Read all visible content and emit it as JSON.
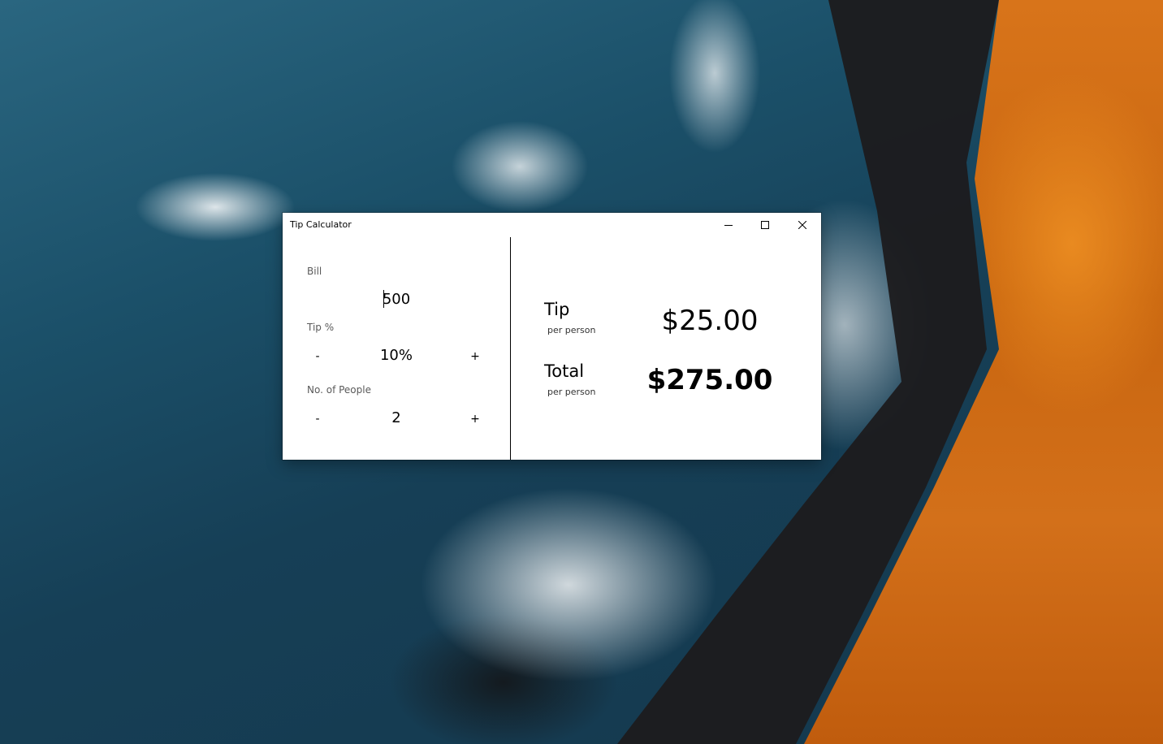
{
  "window": {
    "title": "Tip Calculator"
  },
  "inputs": {
    "bill_label": "Bill",
    "bill_value": "500",
    "tip_label": "Tip %",
    "tip_value": "10%",
    "people_label": "No. of People",
    "people_value": "2",
    "minus_label": "-",
    "plus_label": "+"
  },
  "results": {
    "tip_label": "Tip",
    "tip_sub": "per person",
    "tip_amount": "$25.00",
    "total_label": "Total",
    "total_sub": "per person",
    "total_amount": "$275.00"
  },
  "icons": {
    "minimize": "minimize-icon",
    "maximize": "maximize-icon",
    "close": "close-icon"
  }
}
